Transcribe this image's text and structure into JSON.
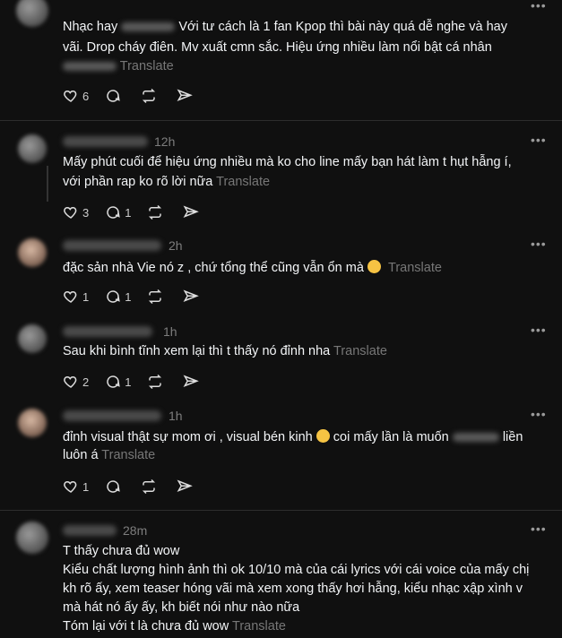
{
  "posts": [
    {
      "lines": [
        "Nhạc hay",
        "Với tư cách là 1 fan Kpop thì bài này quá dễ nghe và hay",
        "vãi. Drop cháy điên. Mv xuất cmn sắc. Hiệu ứng nhiều làm nổi bật cá nhân"
      ],
      "translate": "Translate",
      "likes": "6"
    },
    {
      "time": "12h",
      "lines": [
        "Mấy phút cuối để hiệu ứng nhiều mà ko cho line mấy bạn hát làm t hụt hẫng í,",
        "với phần rap ko rõ lời nữa"
      ],
      "translate": "Translate",
      "likes": "3",
      "replies": "1"
    },
    {
      "time": "2h",
      "lines": [
        "đặc sản nhà Vie nó z , chứ tổng thể cũng vẫn ổn mà"
      ],
      "translate": "Translate",
      "likes": "1",
      "replies": "1"
    },
    {
      "time": "1h",
      "lines": [
        "Sau khi bình tĩnh xem lại thì t thấy nó đỉnh nha"
      ],
      "translate": "Translate",
      "likes": "2",
      "replies": "1"
    },
    {
      "time": "1h",
      "lines": [
        "đỉnh visual thật sự mom ơi , visual bén kinh",
        "coi mấy lần là muốn",
        "liền",
        "luôn á"
      ],
      "translate": "Translate",
      "likes": "1"
    },
    {
      "time": "28m",
      "lines": [
        "T thấy chưa đủ wow",
        "Kiểu chất lượng hình ảnh thì ok 10/10 mà của cái lyrics với cái voice của mấy chị",
        "kh rõ ấy, xem teaser hóng vãi mà xem xong thấy hơi hẫng, kiểu nhạc xập xình v",
        "mà hát nó ấy ấy, kh biết nói như nào nữa",
        "Tóm lại với t là chưa đủ wow"
      ],
      "translate": "Translate"
    }
  ],
  "more_label": "•••"
}
